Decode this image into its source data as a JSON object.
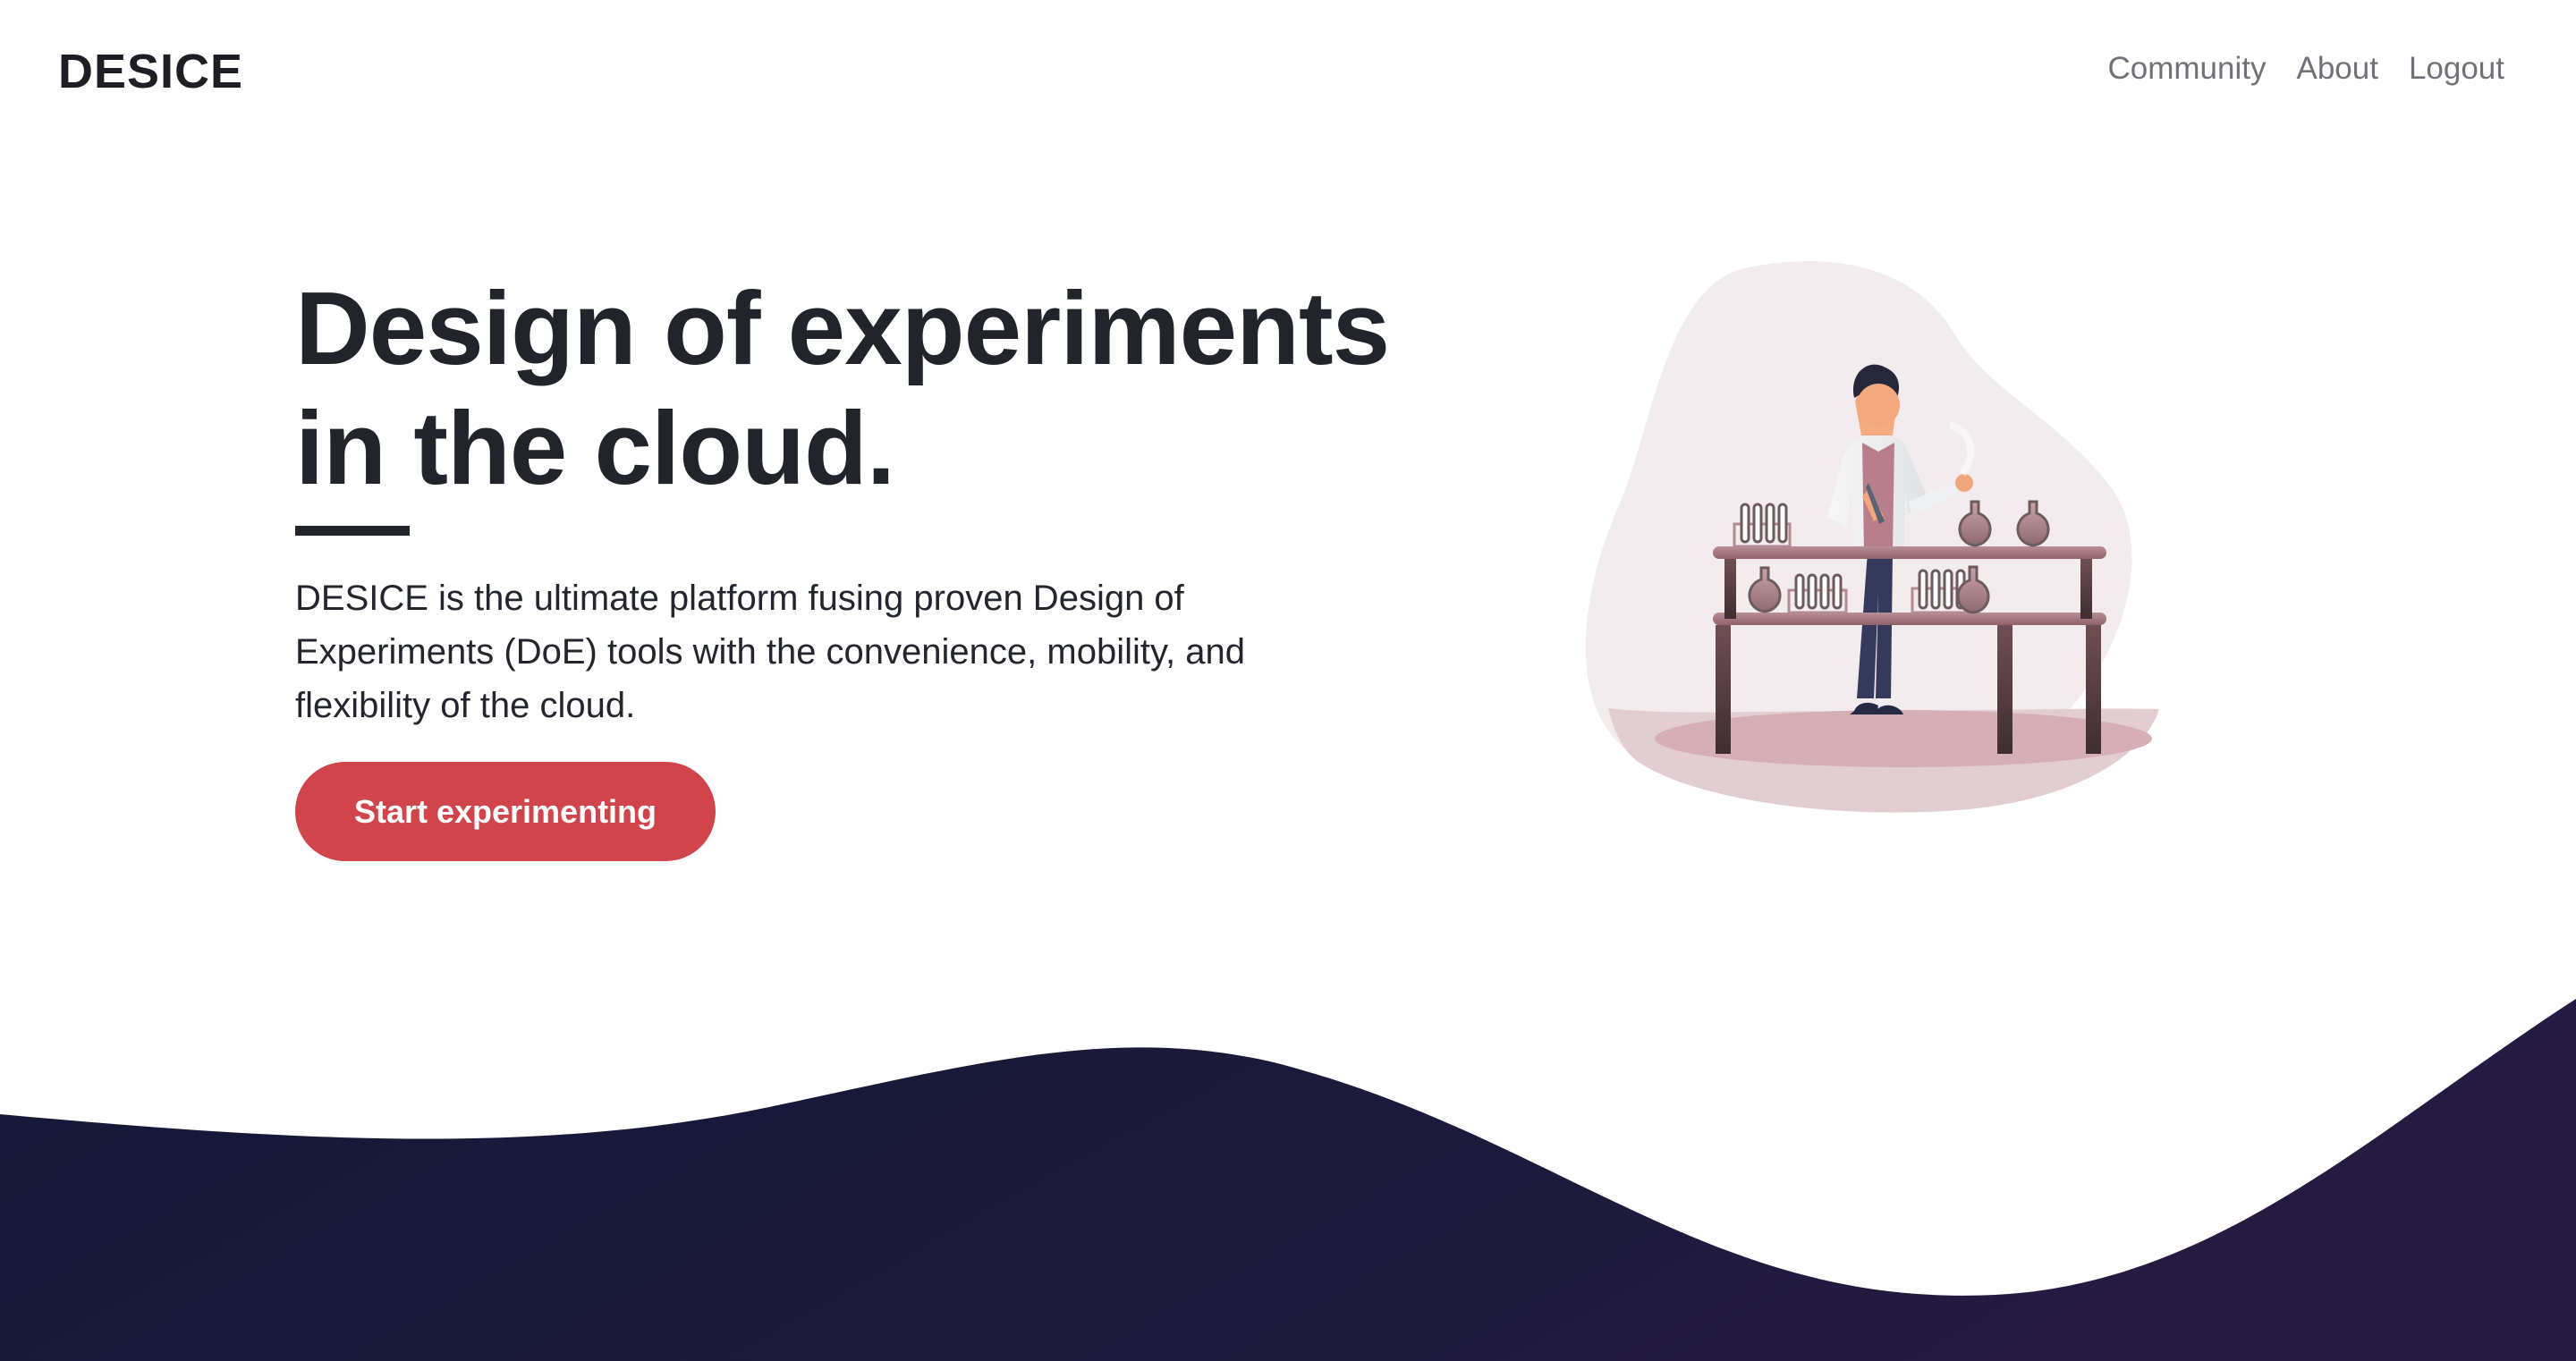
{
  "navbar": {
    "brand": "DESICE",
    "links": [
      "Community",
      "About",
      "Logout"
    ]
  },
  "hero": {
    "title_line_1": "Design of experiments",
    "title_line_2": "in the cloud.",
    "description": "DESICE is the ultimate platform fusing proven Design of Experiments (DoE) tools with the convenience, mobility, and flexibility of the cloud.",
    "button_label": "Start experimenting"
  },
  "illustration": {
    "icon": "scientist-lab-illustration",
    "colors": {
      "blob": "#f3eced",
      "floor": "#e5cfd2",
      "liquid": "#bb8890",
      "table": "#8b5a62"
    }
  },
  "colors": {
    "accent": "#d0454c",
    "text": "#22242b",
    "muted_text": "#707277",
    "wave_dark": "#171736",
    "wave_purple": "#241a41"
  }
}
